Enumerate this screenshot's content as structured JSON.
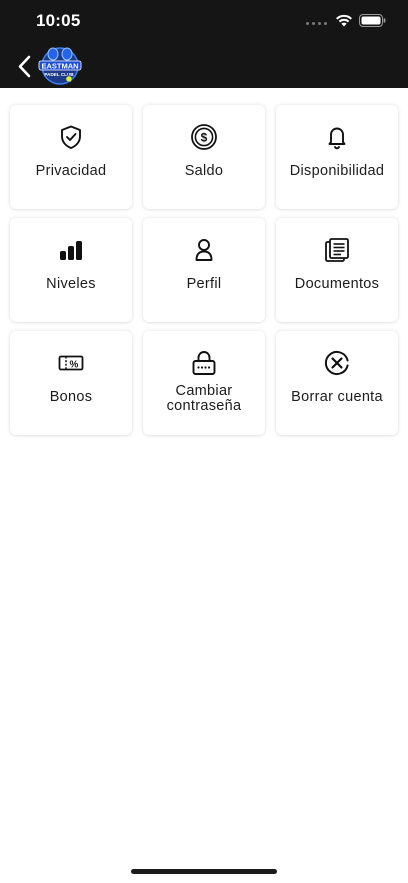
{
  "status_bar": {
    "time": "10:05"
  },
  "nav": {
    "logo_line1": "EASTMAN",
    "logo_line2": "PADEL CLUB"
  },
  "menu": [
    {
      "label": "Privacidad",
      "icon": "shield-check-icon"
    },
    {
      "label": "Saldo",
      "icon": "dollar-coin-icon"
    },
    {
      "label": "Disponibilidad",
      "icon": "bell-icon"
    },
    {
      "label": "Niveles",
      "icon": "bar-levels-icon"
    },
    {
      "label": "Perfil",
      "icon": "user-icon"
    },
    {
      "label": "Documentos",
      "icon": "documents-icon"
    },
    {
      "label": "Bonos",
      "icon": "voucher-icon"
    },
    {
      "label": "Cambiar\ncontraseña",
      "icon": "lock-password-icon"
    },
    {
      "label": "Borrar cuenta",
      "icon": "delete-account-icon"
    }
  ],
  "colors": {
    "header_bg": "#151515",
    "tile_bg": "#ffffff",
    "text": "#1c1c1c",
    "logo_blue": "#1e3a8a"
  }
}
